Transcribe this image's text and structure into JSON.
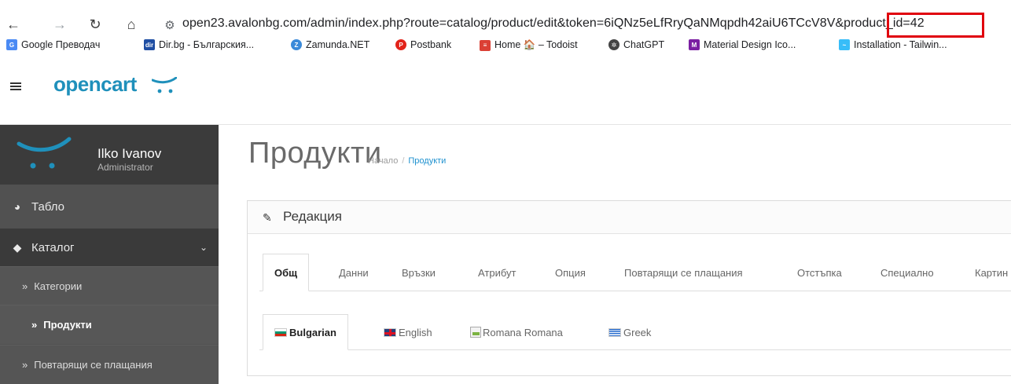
{
  "browser": {
    "url": "open23.avalonbg.com/admin/index.php?route=catalog/product/edit&token=6iQNz5eLfRryQaNMqpdh42aiU6TCcV8V&product_id=42",
    "bookmarks": [
      {
        "label": "Google Преводач",
        "icon": "google-translate-icon",
        "color": "#4a8af4"
      },
      {
        "label": "Dir.bg - Българския...",
        "icon": "dir-icon",
        "color": "#1f4ea3"
      },
      {
        "label": "Zamunda.NET",
        "icon": "zamunda-icon",
        "color": "#3b8ad9"
      },
      {
        "label": "Postbank",
        "icon": "postbank-icon",
        "color": "#e2231a"
      },
      {
        "label": "Home 🏠 – Todoist",
        "icon": "todoist-icon",
        "color": "#db4035"
      },
      {
        "label": "ChatGPT",
        "icon": "chatgpt-icon",
        "color": "#444444"
      },
      {
        "label": "Material Design Ico...",
        "icon": "material-icon",
        "color": "#7b1fa2"
      },
      {
        "label": "Installation - Tailwin...",
        "icon": "tailwind-icon",
        "color": "#38bdf8"
      }
    ]
  },
  "header": {
    "logo": "opencart"
  },
  "sidebar": {
    "user_name": "Ilko Ivanov",
    "user_role": "Administrator",
    "dashboard": "Табло",
    "catalog": "Каталог",
    "sub_items": [
      "Категории",
      "Продукти",
      "Повтарящи се плащания"
    ]
  },
  "content": {
    "title": "Продукти",
    "breadcrumb_home": "Начало",
    "breadcrumb_sep": "/",
    "breadcrumb_current": "Продукти",
    "panel_title": "Редакция",
    "tabs": [
      "Общ",
      "Данни",
      "Връзки",
      "Атрибут",
      "Опция",
      "Повтарящи се плащания",
      "Отстъпка",
      "Специално",
      "Картин"
    ],
    "languages": [
      "Bulgarian",
      "English",
      "Romana Romana",
      "Greek"
    ]
  },
  "colors": {
    "accent": "#1e91cf",
    "highlight": "#e0000d"
  }
}
